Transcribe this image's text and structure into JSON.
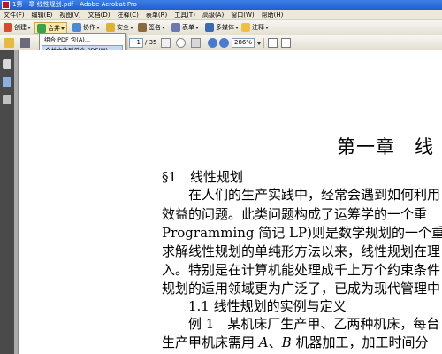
{
  "window": {
    "title": "1第一章 线性规划.pdf - Adobe Acrobat Pro"
  },
  "menubar": {
    "items": [
      "文件(F)",
      "编辑(E)",
      "视图(V)",
      "文档(D)",
      "注释(C)",
      "表单(R)",
      "工具(T)",
      "高级(A)",
      "窗口(W)",
      "帮助(H)"
    ]
  },
  "toolbar": {
    "create_label": "创建",
    "combine_label": "合并",
    "collaborate_label": "协作",
    "secure_label": "安全",
    "sign_label": "签名",
    "forms_label": "表单",
    "multimedia_label": "多媒体",
    "comment_label": "注释",
    "current_page": "1",
    "page_count": "/ 35",
    "zoom": "286%"
  },
  "dropdown": {
    "items": [
      "组合 PDF 包(A)...",
      "合并文件到单个 PDF(M)..."
    ],
    "highlighted_index": 1
  },
  "document": {
    "chapter_title": "第一章　线",
    "lines": [
      "§1　线性规划",
      "　　在人们的生产实践中，经常会遇到如何利用",
      "效益的问题。此类问题构成了运筹学的一个重",
      "Programming 简记 LP)则是数学规划的一个重要",
      "求解线性规划的单纯形方法以来，线性规划在理",
      "入。特别是在计算机能处理成千上万个约束条件",
      "规划的适用领域更为广泛了，已成为现代管理中",
      "　　1.1 线性规划的实例与定义",
      "　　例 1　某机床厂生产甲、乙两种机床，每台",
      "生产甲机床需用"
    ],
    "last_line_var_a": "A",
    "last_line_sep": "、",
    "last_line_var_b": "B",
    "last_line_tail": " 机器加工，加工时间分"
  },
  "colors": {
    "titlebar": "#2a6ad8",
    "toolbar_bg": "#ece9d8",
    "nav_panel": "#4a4a4a",
    "highlight": "#c8d8f0"
  }
}
